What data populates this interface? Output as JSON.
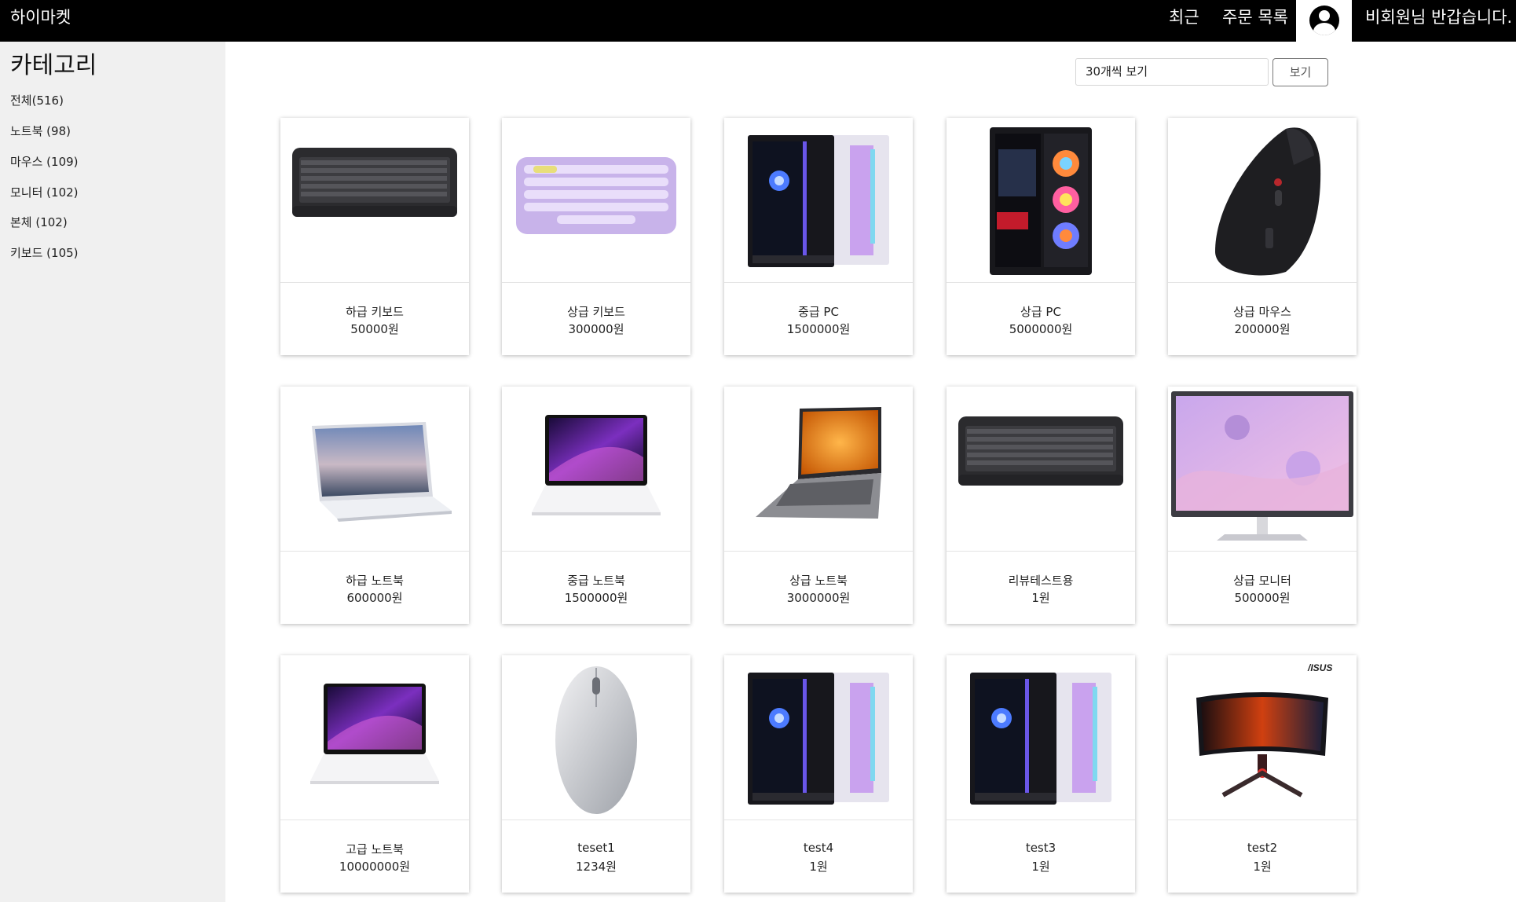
{
  "header": {
    "brand": "하이마켓",
    "nav_recent": "최근",
    "nav_orders": "주문 목록",
    "greeting": "비회원님 반갑습니다."
  },
  "sidebar": {
    "title": "카테고리",
    "categories": [
      {
        "label": "전체(516)"
      },
      {
        "label": "노트북 (98)"
      },
      {
        "label": "마우스 (109)"
      },
      {
        "label": "모니터 (102)"
      },
      {
        "label": "본체 (102)"
      },
      {
        "label": "키보드 (105)"
      }
    ]
  },
  "controls": {
    "per_page_value": "30개씩 보기",
    "view_button": "보기"
  },
  "products": [
    {
      "name": "하급 키보드",
      "price": "50000원",
      "image": "black-keyboard"
    },
    {
      "name": "상급 키보드",
      "price": "300000원",
      "image": "purple-keyboard"
    },
    {
      "name": "중급 PC",
      "price": "1500000원",
      "image": "pc-case-pair"
    },
    {
      "name": "상급 PC",
      "price": "5000000원",
      "image": "rgb-pc-case"
    },
    {
      "name": "상급 마우스",
      "price": "200000원",
      "image": "vertical-mouse"
    },
    {
      "name": "하급 노트북",
      "price": "600000원",
      "image": "white-laptop"
    },
    {
      "name": "중급 노트북",
      "price": "1500000원",
      "image": "purple-screen-laptop"
    },
    {
      "name": "상급 노트북",
      "price": "3000000원",
      "image": "gray-laptop"
    },
    {
      "name": "리뷰테스트용",
      "price": "1원",
      "image": "black-keyboard"
    },
    {
      "name": "상급 모니터",
      "price": "500000원",
      "image": "monitor"
    },
    {
      "name": "고급 노트북",
      "price": "10000000원",
      "image": "purple-screen-laptop"
    },
    {
      "name": "teset1",
      "price": "1234원",
      "image": "silver-mouse"
    },
    {
      "name": "test4",
      "price": "1원",
      "image": "pc-case-pair"
    },
    {
      "name": "test3",
      "price": "1원",
      "image": "pc-case-pair"
    },
    {
      "name": "test2",
      "price": "1원",
      "image": "curved-monitor"
    }
  ]
}
